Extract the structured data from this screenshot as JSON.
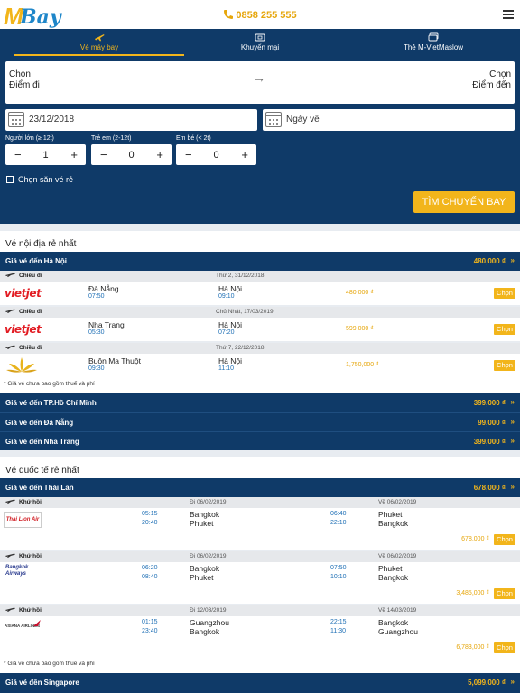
{
  "header": {
    "logo_m": "M",
    "logo_bay": "Bay",
    "phone": "0858 255 555"
  },
  "tabs": [
    {
      "label": "Vé máy bay"
    },
    {
      "label": "Khuyến mại"
    },
    {
      "label": "Thẻ M-VietMaslow"
    }
  ],
  "search": {
    "origin": [
      "Chọn",
      "Điểm đi"
    ],
    "destination": [
      "Chọn",
      "Điểm đến"
    ],
    "depart_date": "23/12/2018",
    "return_placeholder": "Ngày về",
    "adults": {
      "label": "Người lớn (≥ 12t)",
      "value": "1"
    },
    "children": {
      "label": "Trẻ em (2-12t)",
      "value": "0"
    },
    "infants": {
      "label": "Em bé (< 2t)",
      "value": "0"
    },
    "cheap_label": "Chọn săn vé rẻ",
    "button": "TÌM CHUYẾN BAY",
    "minus": "−",
    "plus": "+"
  },
  "domestic": {
    "title": "Vé nội địa rẻ nhất",
    "header_group": {
      "label": "Giá vé đến Hà Nội",
      "price": "480,000 ₫",
      "chev": "»"
    },
    "flights": [
      {
        "dir": "Chiều đi",
        "date": "Thứ 2, 31/12/2018",
        "airline": "vietjet",
        "from": "Đà Nẵng",
        "dep": "07:50",
        "to": "Hà Nội",
        "arr": "09:10",
        "price": "480,000 ₫",
        "btn": "Chọn"
      },
      {
        "dir": "Chiều đi",
        "date": "Chủ Nhật, 17/03/2019",
        "airline": "vietjet",
        "from": "Nha Trang",
        "dep": "05:30",
        "to": "Hà Nội",
        "arr": "07:20",
        "price": "599,000 ₫",
        "btn": "Chọn"
      },
      {
        "dir": "Chiều đi",
        "date": "Thứ 7, 22/12/2018",
        "airline": "vietnam-airlines",
        "from": "Buôn Ma Thuột",
        "dep": "09:30",
        "to": "Hà Nội",
        "arr": "11:10",
        "price": "1,750,000 ₫",
        "btn": "Chọn"
      }
    ],
    "note": "* Giá vé chưa bao gồm thuế và phí",
    "groups": [
      {
        "label": "Giá vé đến TP.Hồ Chí Minh",
        "price": "399,000 ₫",
        "chev": "»"
      },
      {
        "label": "Giá vé đến Đà Nẵng",
        "price": "99,000 ₫",
        "chev": "»"
      },
      {
        "label": "Giá vé đến Nha Trang",
        "price": "399,000 ₫",
        "chev": "»"
      }
    ],
    "vietjet_logo": "vietjet"
  },
  "international": {
    "title": "Vé quốc tế rẻ nhất",
    "header_group": {
      "label": "Giá vé đến Thái Lan",
      "price": "678,000 ₫",
      "chev": "»"
    },
    "flights": [
      {
        "dir": "Khứ hồi",
        "out_date": "Đi 06/02/2019",
        "ret_date": "Về 06/02/2019",
        "airline": "thai-lion-air",
        "logo": "Thai Lion Air",
        "t1": "05:15",
        "t2": "20:40",
        "c1": "Bangkok",
        "c2": "Phuket",
        "t3": "06:40",
        "t4": "22:10",
        "c3": "Phuket",
        "c4": "Bangkok",
        "price": "678,000 ₫",
        "btn": "Chọn"
      },
      {
        "dir": "Khứ hồi",
        "out_date": "Đi 06/02/2019",
        "ret_date": "Về 06/02/2019",
        "airline": "bangkok-airways",
        "logo": "Bangkok Airways",
        "t1": "06:20",
        "t2": "08:40",
        "c1": "Bangkok",
        "c2": "Phuket",
        "t3": "07:50",
        "t4": "10:10",
        "c3": "Phuket",
        "c4": "Bangkok",
        "price": "3,485,000 ₫",
        "btn": "Chọn"
      },
      {
        "dir": "Khứ hồi",
        "out_date": "Đi 12/03/2019",
        "ret_date": "Về 14/03/2019",
        "airline": "asiana-airlines",
        "logo": "ASIANA AIRLINES",
        "t1": "01:15",
        "t2": "23:40",
        "c1": "Guangzhou",
        "c2": "Bangkok",
        "t3": "22:15",
        "t4": "11:30",
        "c3": "Bangkok",
        "c4": "Guangzhou",
        "price": "6,783,000 ₫",
        "btn": "Chọn"
      }
    ],
    "note": "* Giá vé chưa bao gồm thuế và phí",
    "groups": [
      {
        "label": "Giá vé đến Singapore",
        "price": "5,099,000 ₫",
        "chev": "»"
      }
    ]
  },
  "colors": {
    "navy": "#0f3a68",
    "accent": "#f2b51b",
    "blue": "#1e6fb5"
  }
}
